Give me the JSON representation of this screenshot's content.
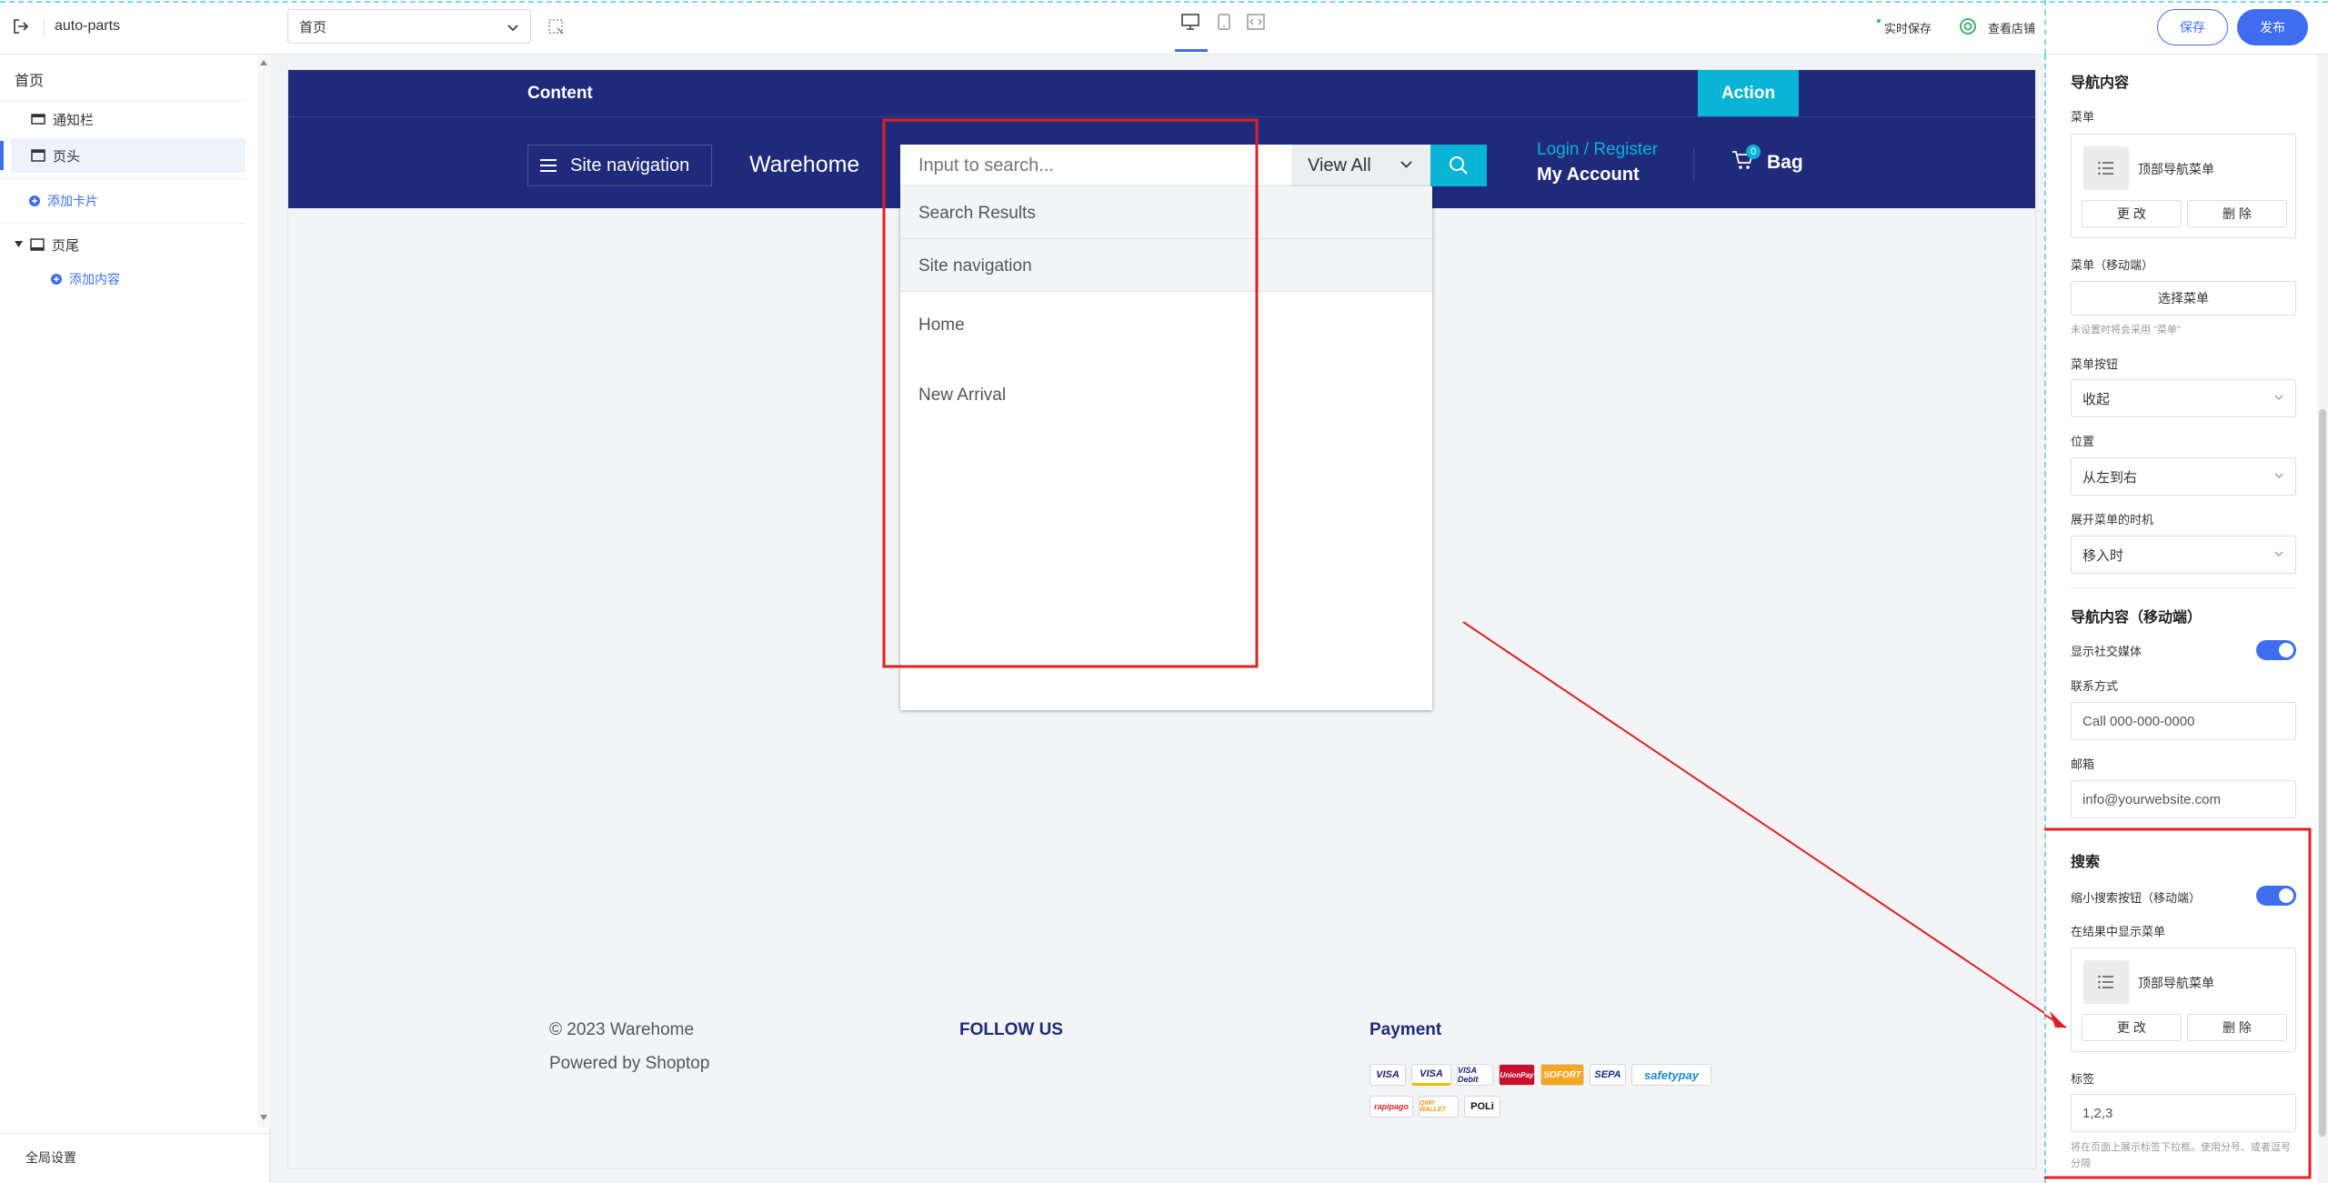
{
  "topbar": {
    "app_name": "auto-parts",
    "page_select": "首页",
    "realtime_save": "实时保存",
    "view_store": "查看店铺",
    "save_button": "保存",
    "publish_button": "发布",
    "device_icons": [
      "desktop-icon",
      "tablet-icon",
      "code-icon"
    ]
  },
  "left_panel": {
    "title": "首页",
    "items": [
      {
        "label": "通知栏",
        "icon": "notice-bar-icon"
      },
      {
        "label": "页头",
        "icon": "header-icon",
        "selected": true
      }
    ],
    "add_card": "添加卡片",
    "footer_section": {
      "label": "页尾",
      "icon": "footer-icon"
    },
    "add_content": "添加内容",
    "global_settings": "全局设置"
  },
  "site": {
    "announcement": {
      "content": "Content",
      "action": "Action"
    },
    "nav_button": "Site navigation",
    "logo": "Warehome",
    "search": {
      "placeholder": "Input to search...",
      "scope": "View All",
      "results_header": "Search Results",
      "nav_header": "Site navigation",
      "menu_items": [
        "Home",
        "New Arrival"
      ]
    },
    "account": {
      "login": "Login / Register",
      "my_account": "My Account"
    },
    "bag": {
      "label": "Bag",
      "count": "0"
    },
    "footer": {
      "copyright": "© 2023 Warehome",
      "powered": "Powered by Shoptop",
      "follow": "FOLLOW US",
      "payment": "Payment",
      "payment_icons": [
        "VISA",
        "VISA",
        "VISA Debit",
        "UnionPay",
        "SOFORT",
        "SEPA",
        "safetypay",
        "rapipago",
        "QIWI WALLET",
        "POLi"
      ]
    }
  },
  "right_panel": {
    "nav_section_title": "导航内容",
    "menu_label": "菜单",
    "menu_name": "顶部导航菜单",
    "change_button": "更 改",
    "delete_button": "删 除",
    "mobile_menu_label": "菜单（移动端）",
    "select_menu_button": "选择菜单",
    "mobile_menu_hint": "未设置时将会采用 \"菜单\"",
    "menu_button_label": "菜单按钮",
    "menu_button_value": "收起",
    "position_label": "位置",
    "position_value": "从左到右",
    "expand_label": "展开菜单的时机",
    "expand_value": "移入时",
    "mobile_nav_title": "导航内容（移动端）",
    "show_social_label": "显示社交媒体",
    "contact_label": "联系方式",
    "contact_value": "Call 000-000-0000",
    "email_label": "邮箱",
    "email_value": "info@yourwebsite.com",
    "search_title": "搜索",
    "shrink_search_label": "缩小搜索按钮（移动端）",
    "show_menu_in_results_label": "在结果中显示菜单",
    "tags_label": "标签",
    "tags_value": "1,2,3",
    "tags_hint": "将在页面上展示标签下拉框。使用分号、或者逗号分隔"
  },
  "colors": {
    "header_bg": "#1f2a7a",
    "accent_cyan": "#0ab4d4",
    "primary_blue": "#3f6df0",
    "annotation_red": "#e02020"
  }
}
